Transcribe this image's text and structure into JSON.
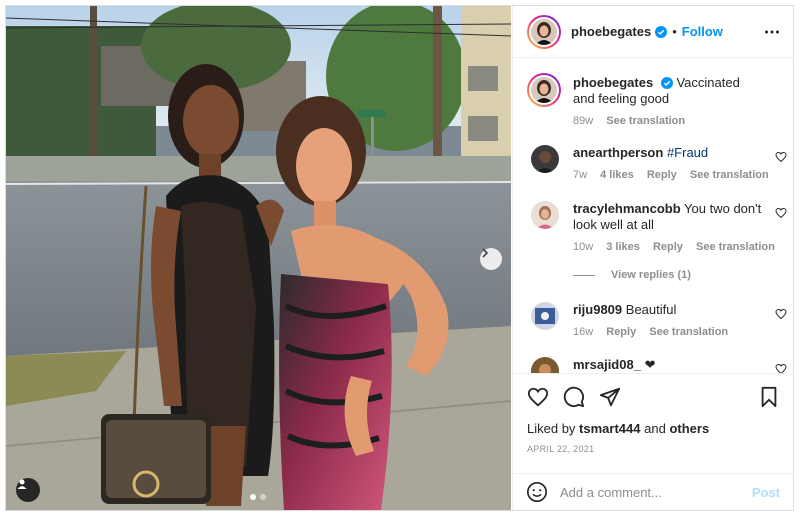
{
  "colors": {
    "accent": "#0095f6",
    "text": "#262626",
    "muted": "#8e8e8e",
    "post_disabled": "#b2dffc"
  },
  "photo": {
    "alt_icons": [
      "chevron-right-icon",
      "user-tag-icon"
    ],
    "carousel": {
      "count": 2,
      "active": 1
    }
  },
  "post": {
    "author": "phoebegates",
    "follow_label": "Follow",
    "separator": "•",
    "caption": "Vaccinated and feeling good",
    "caption_age": "89w",
    "see_translation": "See translation"
  },
  "comments": [
    {
      "user": "anearthperson",
      "text_prefix": "",
      "hashtag": "#Fraud",
      "text": "",
      "age": "7w",
      "likes": "4 likes",
      "reply": "Reply",
      "translate": "See translation"
    },
    {
      "user": "tracylehmancobb",
      "text": "You two don't look well at all",
      "age": "10w",
      "likes": "3 likes",
      "reply": "Reply",
      "translate": "See translation",
      "view_replies": "View replies (1)"
    },
    {
      "user": "riju9809",
      "text": "Beautiful",
      "age": "16w",
      "reply": "Reply",
      "translate": "See translation"
    },
    {
      "user": "mrsajid08_",
      "text": "❤"
    }
  ],
  "engagement": {
    "liked_by_prefix": "Liked by",
    "liked_by_user": "tsmart444",
    "and": "and",
    "others": "others",
    "date": "APRIL 22, 2021"
  },
  "composer": {
    "placeholder": "Add a comment...",
    "post_label": "Post"
  }
}
